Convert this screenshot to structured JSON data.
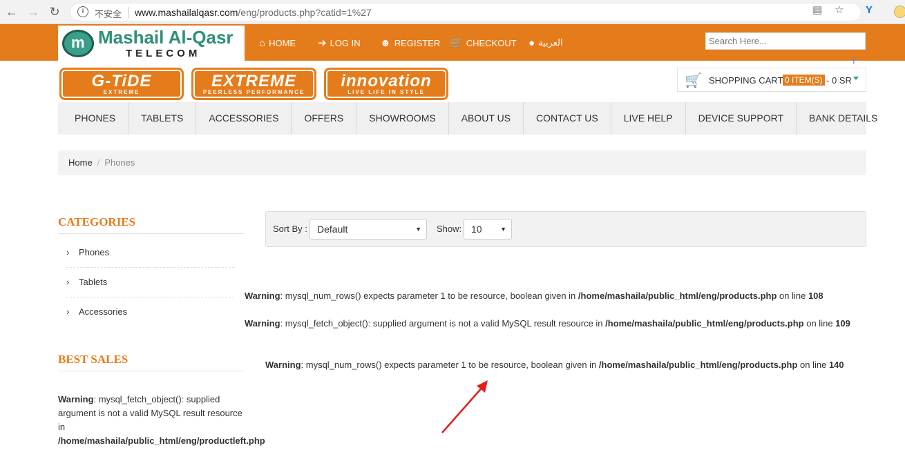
{
  "browser": {
    "secure_label": "不安全",
    "url_host": "www.mashailalqasr.com",
    "url_path": "/eng/products.php?catid=1%27"
  },
  "header": {
    "logo_name": "Mashail Al-Qasr",
    "logo_sub": "TELECOM",
    "nav": [
      {
        "label": "HOME",
        "icon": "home-icon"
      },
      {
        "label": "LOG IN",
        "icon": "login-icon"
      },
      {
        "label": "REGISTER",
        "icon": "user-icon"
      },
      {
        "label": "CHECKOUT",
        "icon": "cart-icon"
      },
      {
        "label": "العربية",
        "icon": "speaker-icon"
      }
    ],
    "search_placeholder": "Search Here..."
  },
  "brands": [
    {
      "big": "G-TiDE",
      "small": "EXTREME"
    },
    {
      "big": "EXTREME",
      "small": "PEERLESS PERFORMANCE"
    },
    {
      "big": "innovation",
      "small": "LIVE LIFE IN STYLE"
    }
  ],
  "cart": {
    "label": "SHOPPING CART",
    "items": "0 ITEM(S)",
    "amount": "- 0 SR"
  },
  "menu": [
    "PHONES",
    "TABLETS",
    "ACCESSORIES",
    "OFFERS",
    "SHOWROOMS",
    "ABOUT US",
    "CONTACT US",
    "LIVE HELP",
    "DEVICE SUPPORT",
    "BANK DETAILS"
  ],
  "breadcrumb": {
    "home": "Home",
    "current": "Phones"
  },
  "sidebar": {
    "categories_title": "CATEGORIES",
    "categories": [
      "Phones",
      "Tablets",
      "Accessories"
    ],
    "best_sales_title": "BEST SALES",
    "warning": {
      "label": "Warning",
      "text": ": mysql_fetch_object(): supplied argument is not a valid MySQL result resource in ",
      "path": "/home/mashaila/public_html/eng/productleft.php"
    }
  },
  "sort": {
    "sort_label": "Sort By :",
    "sort_value": "Default",
    "show_label": "Show:",
    "show_value": "10"
  },
  "warnings": [
    {
      "label": "Warning",
      "text": ": mysql_num_rows() expects parameter 1 to be resource, boolean given in ",
      "path": "/home/mashaila/public_html/eng/products.php",
      "on_line": " on line ",
      "line": "108"
    },
    {
      "label": "Warning",
      "text": ": mysql_fetch_object(): supplied argument is not a valid MySQL result resource in ",
      "path": "/home/mashaila/public_html/eng/products.php",
      "on_line": " on line ",
      "line": "109"
    },
    {
      "label": "Warning",
      "text": ": mysql_num_rows() expects parameter 1 to be resource, boolean given in ",
      "path": "/home/mashaila/public_html/eng/products.php",
      "on_line": " on line ",
      "line": "140"
    }
  ],
  "colors": {
    "accent": "#e57c1b",
    "annotation": "#e0201b"
  }
}
